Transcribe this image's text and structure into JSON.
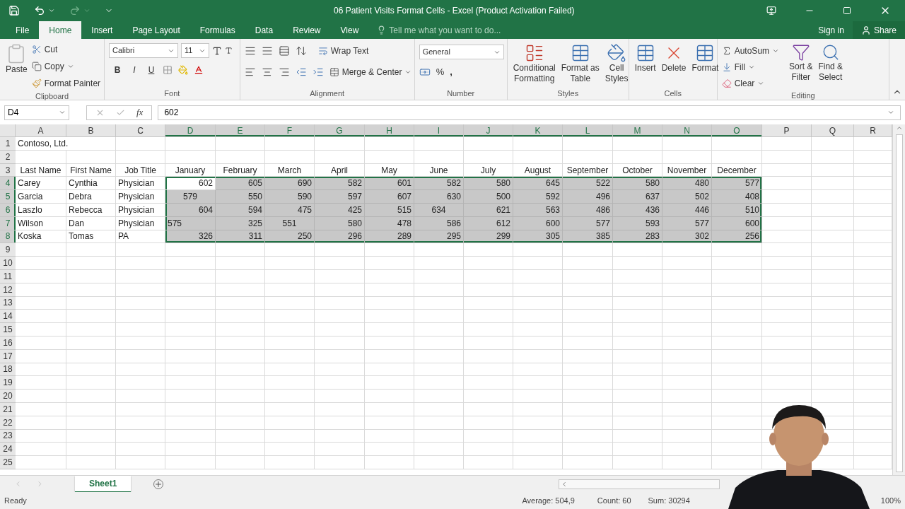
{
  "title_bar": {
    "title": "06 Patient Visits Format Cells - Excel (Product Activation Failed)"
  },
  "menu_tabs": [
    {
      "label": "File",
      "selected": false
    },
    {
      "label": "Home",
      "selected": true
    },
    {
      "label": "Insert",
      "selected": false
    },
    {
      "label": "Page Layout",
      "selected": false
    },
    {
      "label": "Formulas",
      "selected": false
    },
    {
      "label": "Data",
      "selected": false
    },
    {
      "label": "Review",
      "selected": false
    },
    {
      "label": "View",
      "selected": false
    }
  ],
  "tell_me": {
    "placeholder": "Tell me what you want to do..."
  },
  "sign_in": "Sign in",
  "share": "Share",
  "ribbon": {
    "clipboard": {
      "label": "Clipboard",
      "paste": "Paste",
      "cut": "Cut",
      "copy": "Copy",
      "format_painter": "Format Painter"
    },
    "font": {
      "label": "Font",
      "font_name": "Calibri",
      "font_size": "11",
      "bold": "B",
      "italic": "I",
      "underline": "U"
    },
    "alignment": {
      "label": "Alignment",
      "wrap_text": "Wrap Text",
      "merge": "Merge & Center"
    },
    "number": {
      "label": "Number",
      "format": "General",
      "percent": "%",
      "comma": ","
    },
    "styles": {
      "label": "Styles",
      "buttons": [
        [
          "Conditional",
          "Formatting"
        ],
        [
          "Format as",
          "Table"
        ],
        [
          "Cell",
          "Styles"
        ]
      ]
    },
    "cells": {
      "label": "Cells",
      "buttons": [
        "Insert",
        "Delete",
        "Format"
      ]
    },
    "editing": {
      "label": "Editing",
      "autosum": "AutoSum",
      "fill": "Fill",
      "clear": "Clear",
      "buttons": [
        [
          "Sort &",
          "Filter"
        ],
        [
          "Find &",
          "Select"
        ]
      ]
    }
  },
  "formula_bar": {
    "name_box": "D4",
    "fx": "fx",
    "value": "602"
  },
  "columns": [
    {
      "letter": "A",
      "selected": false
    },
    {
      "letter": "B",
      "selected": false
    },
    {
      "letter": "C",
      "selected": false
    },
    {
      "letter": "D",
      "selected": true
    },
    {
      "letter": "E",
      "selected": true
    },
    {
      "letter": "F",
      "selected": true
    },
    {
      "letter": "G",
      "selected": true
    },
    {
      "letter": "H",
      "selected": true
    },
    {
      "letter": "I",
      "selected": true
    },
    {
      "letter": "J",
      "selected": true
    },
    {
      "letter": "K",
      "selected": true
    },
    {
      "letter": "L",
      "selected": true
    },
    {
      "letter": "M",
      "selected": true
    },
    {
      "letter": "N",
      "selected": true
    },
    {
      "letter": "O",
      "selected": true
    },
    {
      "letter": "P",
      "selected": false
    },
    {
      "letter": "Q",
      "selected": false
    },
    {
      "letter": "R",
      "selected": false
    }
  ],
  "rows": [
    {
      "number": "1",
      "selected": false,
      "header": false,
      "cells": [
        "Contoso, Ltd."
      ]
    },
    {
      "number": "2",
      "selected": false
    },
    {
      "number": "3",
      "selected": false,
      "header": true,
      "cells": [
        "Last Name",
        "First Name",
        "Job Title",
        "January",
        "February",
        "March",
        "April",
        "May",
        "June",
        "July",
        "August",
        "September",
        "October",
        "November",
        "December"
      ]
    },
    {
      "number": "4",
      "selected": true,
      "header": false,
      "cells": [
        "Carey",
        "Cynthia",
        "Physician",
        {
          "text": "602",
          "active": true
        },
        "605",
        "690",
        "582",
        "601",
        "582",
        "580",
        "645",
        "522",
        "580",
        "480",
        "577"
      ]
    },
    {
      "number": "5",
      "selected": true,
      "header": false,
      "cells": [
        "Garcia",
        "Debra",
        "Physician",
        {
          "text": "579",
          "kind": "center"
        },
        "550",
        "590",
        "597",
        "607",
        "630",
        "500",
        "592",
        "496",
        "637",
        "502",
        "408"
      ]
    },
    {
      "number": "6",
      "selected": true,
      "header": false,
      "cells": [
        "Laszlo",
        "Rebecca",
        "Physician",
        "604",
        "594",
        "475",
        "425",
        "515",
        {
          "text": "634",
          "kind": "center"
        },
        "621",
        "563",
        "486",
        "436",
        "446",
        "510"
      ]
    },
    {
      "number": "7",
      "selected": true,
      "header": false,
      "cells": [
        "Wilson",
        "Dan",
        "Physician",
        {
          "text": "575",
          "kind": "left"
        },
        "325",
        {
          "text": "551",
          "kind": "center"
        },
        "580",
        "478",
        "586",
        "612",
        "600",
        "577",
        "593",
        "577",
        "600"
      ]
    },
    {
      "number": "8",
      "selected": true,
      "header": false,
      "cells": [
        "Koska",
        "Tomas",
        "PA",
        "326",
        "311",
        "250",
        "296",
        "289",
        "295",
        "299",
        "305",
        "385",
        "283",
        "302",
        "256"
      ]
    },
    {
      "number": "9",
      "selected": false
    },
    {
      "number": "10",
      "selected": false
    },
    {
      "number": "11",
      "selected": false
    },
    {
      "number": "12",
      "selected": false
    },
    {
      "number": "13",
      "selected": false
    },
    {
      "number": "14",
      "selected": false
    },
    {
      "number": "15",
      "selected": false
    },
    {
      "number": "16",
      "selected": false
    },
    {
      "number": "17",
      "selected": false
    },
    {
      "number": "18",
      "selected": false
    },
    {
      "number": "19",
      "selected": false
    },
    {
      "number": "20",
      "selected": false
    },
    {
      "number": "21",
      "selected": false
    },
    {
      "number": "22",
      "selected": false
    },
    {
      "number": "23",
      "selected": false
    },
    {
      "number": "24",
      "selected": false
    },
    {
      "number": "25",
      "selected": false
    }
  ],
  "sheet_tabs": [
    {
      "label": "Sheet1",
      "selected": true
    }
  ],
  "status_bar": {
    "state": "Ready",
    "average": "Average: 504,9",
    "count": "Count: 60",
    "sum": "Sum: 30294",
    "zoom": "100%"
  }
}
